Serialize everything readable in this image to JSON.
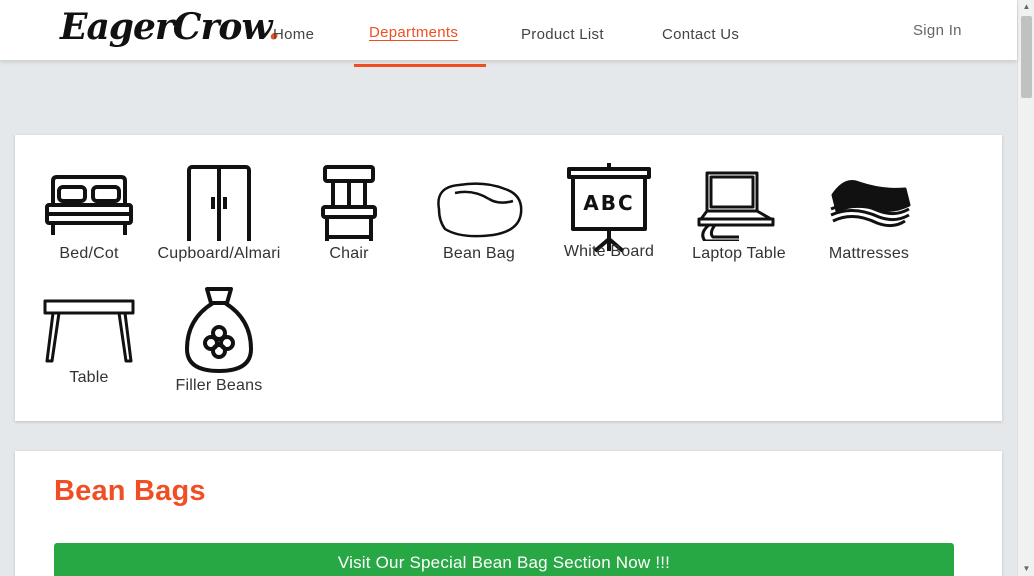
{
  "header": {
    "logo_text": "EagerCrow",
    "logo_dot": ".",
    "nav": [
      {
        "label": "Home"
      },
      {
        "label": "Departments"
      },
      {
        "label": "Product List"
      },
      {
        "label": "Contact Us"
      }
    ],
    "active_nav": "Departments",
    "signin_label": "Sign In",
    "accent_color": "#f04e23"
  },
  "departments": [
    {
      "label": "Bed/Cot",
      "icon": "bed-icon"
    },
    {
      "label": "Cupboard/Almari",
      "icon": "cupboard-icon"
    },
    {
      "label": "Chair",
      "icon": "chair-icon"
    },
    {
      "label": "Bean Bag",
      "icon": "bean-bag-icon"
    },
    {
      "label": "White Board",
      "icon": "white-board-icon"
    },
    {
      "label": "Laptop Table",
      "icon": "laptop-table-icon"
    },
    {
      "label": "Mattresses",
      "icon": "mattress-icon"
    },
    {
      "label": "Table",
      "icon": "table-icon"
    },
    {
      "label": "Filler Beans",
      "icon": "filler-beans-icon"
    }
  ],
  "bean_section": {
    "title": "Bean Bags",
    "button_label": "Visit Our Special Bean Bag Section Now !!!",
    "button_color": "#28a745"
  }
}
